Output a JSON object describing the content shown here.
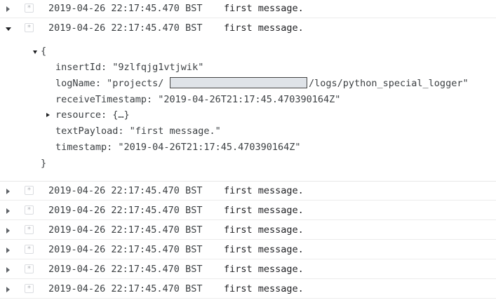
{
  "log": {
    "expanded_index": 1,
    "severity_glyph": "*",
    "rows": [
      {
        "timestamp": "2019-04-26 22:17:45.470 BST",
        "message": "first message."
      },
      {
        "timestamp": "2019-04-26 22:17:45.470 BST",
        "message": "first message."
      },
      {
        "timestamp": "2019-04-26 22:17:45.470 BST",
        "message": "first message."
      },
      {
        "timestamp": "2019-04-26 22:17:45.470 BST",
        "message": "first message."
      },
      {
        "timestamp": "2019-04-26 22:17:45.470 BST",
        "message": "first message."
      },
      {
        "timestamp": "2019-04-26 22:17:45.470 BST",
        "message": "first message."
      },
      {
        "timestamp": "2019-04-26 22:17:45.470 BST",
        "message": "first message."
      },
      {
        "timestamp": "2019-04-26 22:17:45.470 BST",
        "message": "first message."
      }
    ]
  },
  "payload": {
    "open_brace": "{",
    "close_brace": "}",
    "insert_id": "insertId: \"9zlfqjg1vtjwik\"",
    "log_name_prefix": "logName: \"projects/",
    "log_name_suffix": "/logs/python_special_logger\"",
    "receive_timestamp": "receiveTimestamp: \"2019-04-26T21:17:45.470390164Z\"",
    "resource": "resource: {…}",
    "text_payload": "textPayload: \"first message.\"",
    "timestamp": "timestamp: \"2019-04-26T21:17:45.470390164Z\""
  },
  "colors": {
    "redaction_fill": "#dfe3e8",
    "row_divider": "#ececec"
  }
}
